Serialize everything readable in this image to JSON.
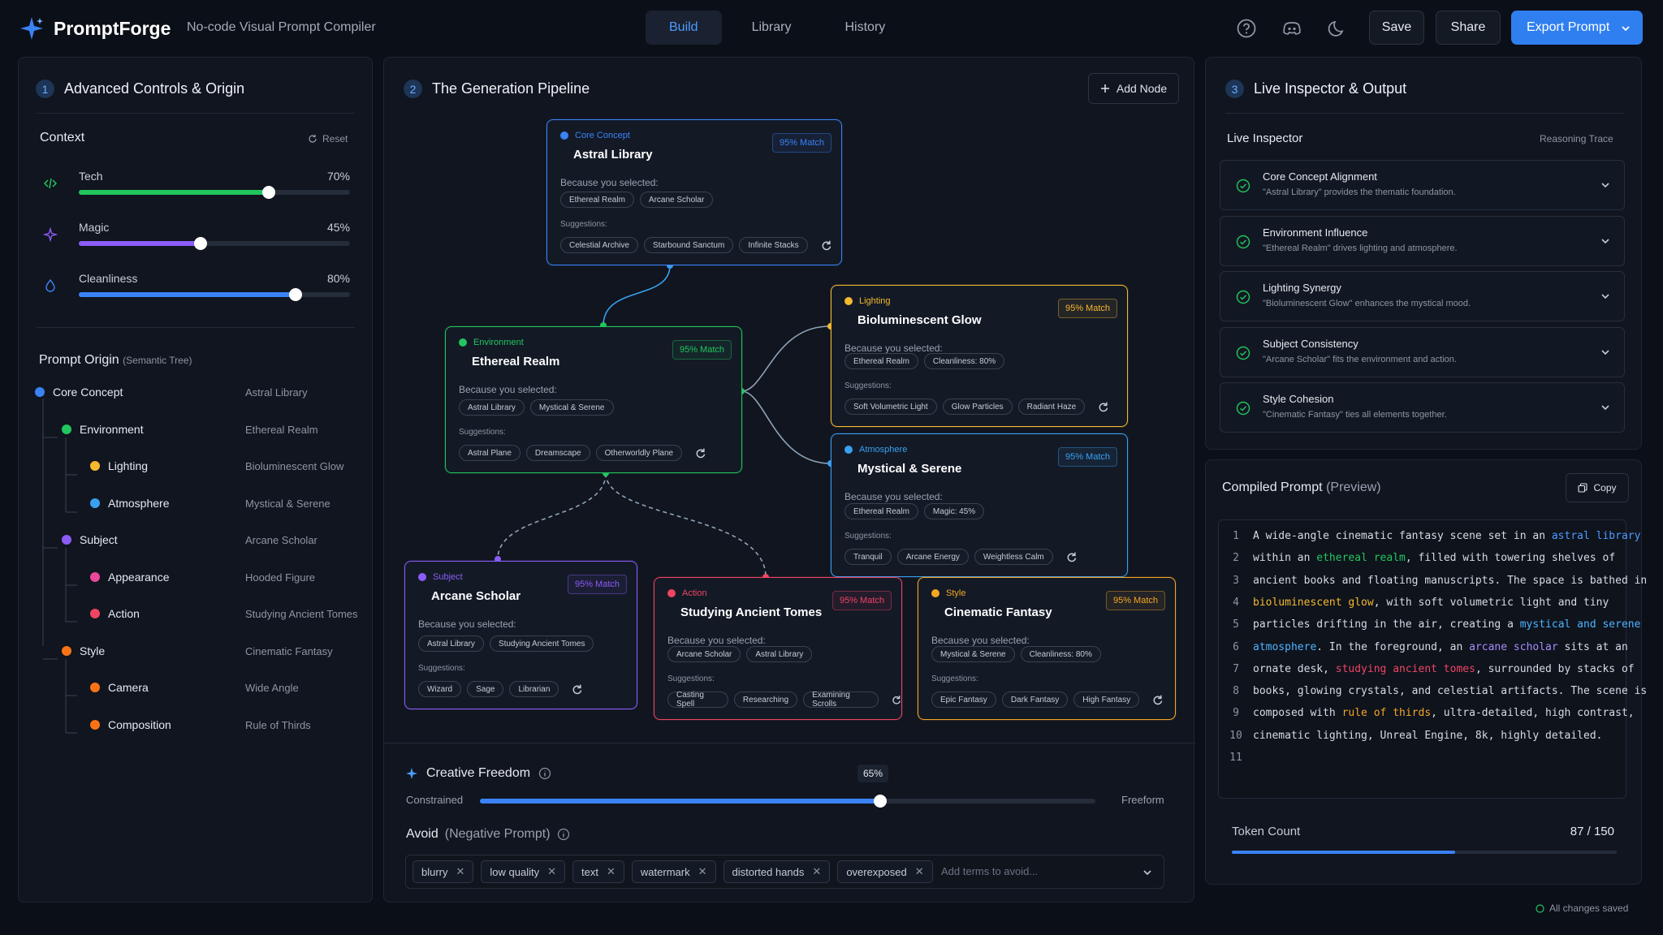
{
  "app": {
    "name": "PromptForge",
    "tagline": "No-code Visual Prompt Compiler"
  },
  "nav": {
    "tabs": [
      "Build",
      "Library",
      "History"
    ],
    "active": "Build"
  },
  "toolbar": {
    "save": "Save",
    "share": "Share",
    "export": "Export Prompt",
    "icons": [
      "help-icon",
      "discord-icon",
      "moon-icon"
    ]
  },
  "left": {
    "num": "1",
    "title": "Advanced Controls & Origin",
    "context_label": "Context",
    "reset": "Reset",
    "sliders": [
      {
        "label": "Tech",
        "value": 70,
        "display": "70%",
        "color": "#22c55e",
        "icon": "code-icon"
      },
      {
        "label": "Magic",
        "value": 45,
        "display": "45%",
        "color": "#8b5cf6",
        "icon": "sparkle-icon"
      },
      {
        "label": "Cleanliness",
        "value": 80,
        "display": "80%",
        "color": "#3b82f6",
        "icon": "droplet-icon"
      }
    ],
    "origin_title": "Prompt Origin",
    "origin_sub": "(Semantic Tree)",
    "tree": [
      {
        "label": "Core Concept",
        "value": "Astral Library",
        "color": "#3b82f6"
      },
      {
        "label": "Environment",
        "value": "Ethereal Realm",
        "color": "#22c55e"
      },
      {
        "label": "Lighting",
        "value": "Bioluminescent Glow",
        "color": "#f5b82e"
      },
      {
        "label": "Atmosphere",
        "value": "Mystical & Serene",
        "color": "#3aa0f0"
      },
      {
        "label": "Subject",
        "value": "Arcane Scholar",
        "color": "#8b5cf6"
      },
      {
        "label": "Appearance",
        "value": "Hooded Figure",
        "color": "#ec4899"
      },
      {
        "label": "Action",
        "value": "Studying Ancient Tomes",
        "color": "#ef4464"
      },
      {
        "label": "Style",
        "value": "Cinematic Fantasy",
        "color": "#f97316"
      },
      {
        "label": "Camera",
        "value": "Wide Angle",
        "color": "#f97316"
      },
      {
        "label": "Composition",
        "value": "Rule of Thirds",
        "color": "#f97316"
      }
    ]
  },
  "middle": {
    "num": "2",
    "title": "The Generation Pipeline",
    "add_node": "Add Node",
    "because_label": "Because you selected:",
    "suggestions_label": "Suggestions:",
    "nodes": [
      {
        "category": "Core Concept",
        "title": "Astral Library",
        "match": "95% Match",
        "color": "#3b82f6",
        "selected": [
          "Ethereal Realm",
          "Arcane Scholar"
        ],
        "suggestions": [
          "Celestial Archive",
          "Starbound Sanctum",
          "Infinite Stacks"
        ]
      },
      {
        "category": "Environment",
        "title": "Ethereal Realm",
        "match": "95% Match",
        "color": "#22c55e",
        "selected": [
          "Astral Library",
          "Mystical & Serene"
        ],
        "suggestions": [
          "Astral Plane",
          "Dreamscape",
          "Otherworldly Plane"
        ]
      },
      {
        "category": "Lighting",
        "title": "Bioluminescent Glow",
        "match": "95% Match",
        "color": "#f5b82e",
        "selected": [
          "Ethereal Realm",
          "Cleanliness: 80%"
        ],
        "suggestions": [
          "Soft Volumetric Light",
          "Glow Particles",
          "Radiant Haze"
        ]
      },
      {
        "category": "Atmosphere",
        "title": "Mystical & Serene",
        "match": "95% Match",
        "color": "#3aa0f0",
        "selected": [
          "Ethereal Realm",
          "Magic: 45%"
        ],
        "suggestions": [
          "Tranquil",
          "Arcane Energy",
          "Weightless Calm"
        ]
      },
      {
        "category": "Subject",
        "title": "Arcane Scholar",
        "match": "95% Match",
        "color": "#8b5cf6",
        "selected": [
          "Astral Library",
          "Studying Ancient Tomes"
        ],
        "suggestions": [
          "Wizard",
          "Sage",
          "Librarian"
        ]
      },
      {
        "category": "Action",
        "title": "Studying Ancient Tomes",
        "match": "95% Match",
        "color": "#ef4464",
        "selected": [
          "Arcane Scholar",
          "Astral Library"
        ],
        "suggestions": [
          "Casting Spell",
          "Researching",
          "Examining Scrolls"
        ]
      },
      {
        "category": "Style",
        "title": "Cinematic Fantasy",
        "match": "95% Match",
        "color": "#f5a524",
        "selected": [
          "Mystical & Serene",
          "Cleanliness: 80%"
        ],
        "suggestions": [
          "Epic Fantasy",
          "Dark Fantasy",
          "High Fantasy"
        ]
      }
    ],
    "freedom": {
      "title": "Creative Freedom",
      "value": 65,
      "display": "65%",
      "left": "Constrained",
      "right": "Freeform"
    },
    "avoid": {
      "title": "Avoid",
      "sub": "(Negative Prompt)",
      "tags": [
        "blurry",
        "low quality",
        "text",
        "watermark",
        "distorted hands",
        "overexposed"
      ],
      "placeholder": "Add terms to avoid..."
    }
  },
  "right": {
    "num": "3",
    "title": "Live Inspector & Output",
    "inspector_label": "Live Inspector",
    "trace": "Reasoning Trace",
    "items": [
      {
        "title": "Core Concept Alignment",
        "desc": "\"Astral Library\" provides the thematic foundation."
      },
      {
        "title": "Environment Influence",
        "desc": "\"Ethereal Realm\" drives lighting and atmosphere."
      },
      {
        "title": "Lighting Synergy",
        "desc": "\"Bioluminescent Glow\" enhances the mystical mood."
      },
      {
        "title": "Subject Consistency",
        "desc": "\"Arcane Scholar\" fits the environment and action."
      },
      {
        "title": "Style Cohesion",
        "desc": "\"Cinematic Fantasy\" ties all elements together."
      }
    ],
    "compiled_title": "Compiled Prompt",
    "compiled_sub": "(Preview)",
    "copy": "Copy",
    "lines": [
      [
        [
          "A wide-angle cinematic fantasy scene set in an ",
          ""
        ],
        [
          "astral library",
          "#4d9bff"
        ]
      ],
      [
        [
          "within an ",
          ""
        ],
        [
          "ethereal realm",
          "#22c55e"
        ],
        [
          ", filled with towering shelves of",
          ""
        ]
      ],
      [
        [
          "ancient books and floating manuscripts. The space is bathed in",
          ""
        ]
      ],
      [
        [
          "bioluminescent glow",
          "#f5b82e"
        ],
        [
          ", with soft volumetric light and tiny",
          ""
        ]
      ],
      [
        [
          "particles drifting in the air, creating a ",
          ""
        ],
        [
          "mystical and serene",
          "#4db4ff"
        ]
      ],
      [
        [
          "atmosphere",
          "#4db4ff"
        ],
        [
          ". In the foreground, an ",
          ""
        ],
        [
          "arcane scholar",
          "#a78bfa"
        ],
        [
          " sits at an",
          ""
        ]
      ],
      [
        [
          "ornate desk, ",
          ""
        ],
        [
          "studying ancient tomes",
          "#ef4464"
        ],
        [
          ", surrounded by stacks of",
          ""
        ]
      ],
      [
        [
          "books, glowing crystals, and celestial artifacts. The scene is",
          ""
        ]
      ],
      [
        [
          "composed with ",
          ""
        ],
        [
          "rule of thirds",
          "#f5a524"
        ],
        [
          ", ultra-detailed, high contrast,",
          ""
        ]
      ],
      [
        [
          "cinematic lighting, Unreal Engine, 8k, highly detailed.",
          ""
        ]
      ],
      [
        [
          "",
          ""
        ]
      ]
    ],
    "token_label": "Token Count",
    "token_value": "87 / 150",
    "token_fraction": 0.58
  },
  "status": "All changes saved"
}
